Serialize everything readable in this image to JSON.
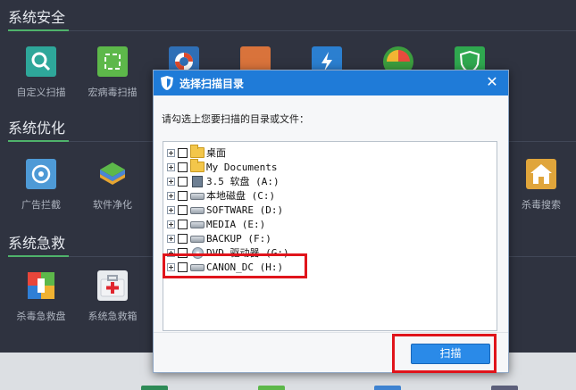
{
  "sections": {
    "security": "系统安全",
    "optimize": "系统优化",
    "rescue": "系统急救"
  },
  "tools": {
    "custom_scan": "自定义扫描",
    "macro_scan": "宏病毒扫描",
    "ad_block": "广告拦截",
    "software_clean": "软件净化",
    "kill_search": "杀毒搜索",
    "rescue_disk": "杀毒急救盘",
    "rescue_box": "系统急救箱"
  },
  "dialog": {
    "title": "选择扫描目录",
    "close": "✕",
    "prompt": "请勾选上您要扫描的目录或文件：",
    "scan_button": "扫描",
    "tree": [
      {
        "label": "桌面",
        "icon": "folder-icon"
      },
      {
        "label": "My Documents",
        "icon": "folder-icon"
      },
      {
        "label": "3.5 软盘 (A:)",
        "icon": "floppy-icon"
      },
      {
        "label": "本地磁盘 (C:)",
        "icon": "drive-icon"
      },
      {
        "label": "SOFTWARE (D:)",
        "icon": "drive-icon"
      },
      {
        "label": "MEDIA (E:)",
        "icon": "drive-icon"
      },
      {
        "label": "BACKUP (F:)",
        "icon": "drive-icon"
      },
      {
        "label": "DVD 驱动器 (G:)",
        "icon": "dvd-icon"
      },
      {
        "label": "CANON_DC (H:)",
        "icon": "drive-icon"
      }
    ]
  },
  "colors": {
    "background": "#2f3340",
    "dialog_titlebar": "#1f7bd8",
    "highlight": "#e0141b",
    "accent": "#4fb36b"
  }
}
